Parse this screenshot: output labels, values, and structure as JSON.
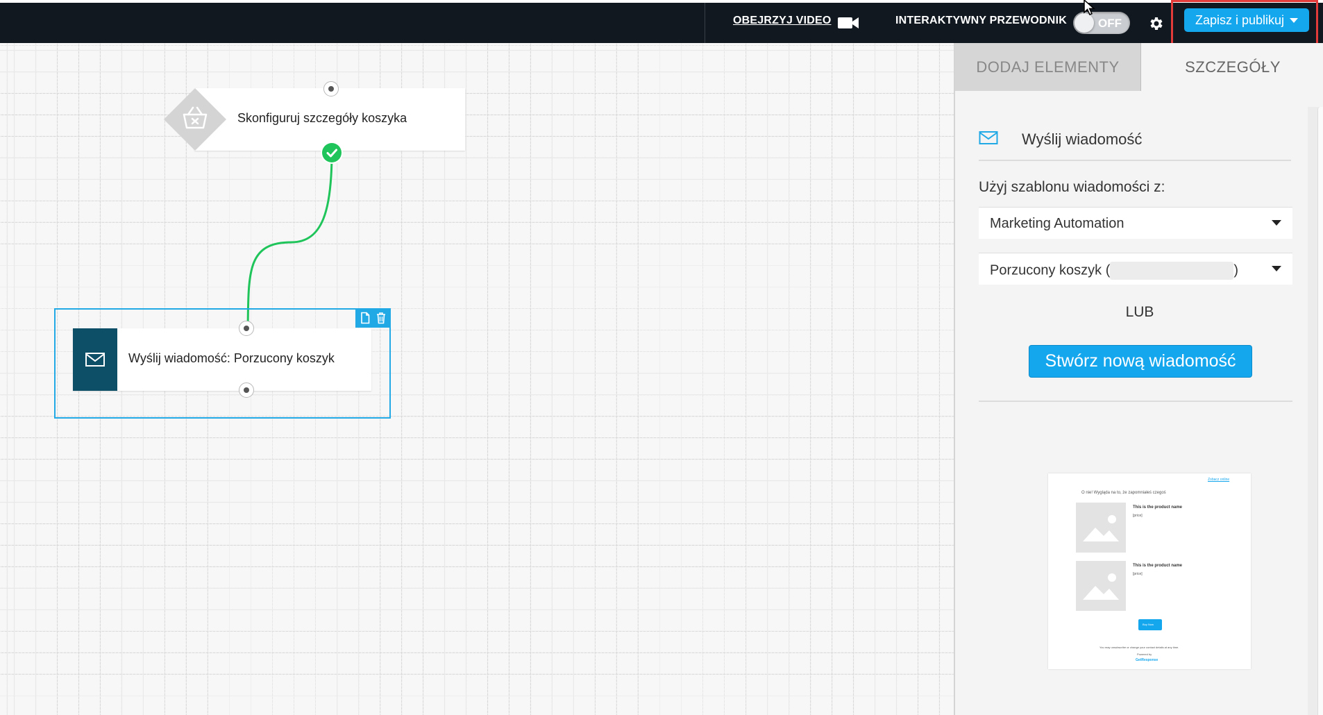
{
  "topbar": {
    "video_label": "OBEJRZYJ VIDEO",
    "video_icon": "video-camera-icon",
    "guide_label": "INTERAKTYWNY PRZEWODNIK",
    "guide_toggle_state": "OFF",
    "settings_icon": "gear-icon",
    "publish_label": "Zapisz i publikuj",
    "publish_color": "#14a7ee",
    "highlight_color": "#e33a3a"
  },
  "canvas": {
    "nodes": [
      {
        "label": "Skonfiguruj szczegóły koszyka",
        "icon": "basket-icon"
      },
      {
        "label": "Wyślij wiadomość: Porzucony koszyk",
        "icon": "envelope-icon"
      }
    ],
    "node_tools": [
      "copy-icon",
      "trash-icon"
    ],
    "connector_color": "#1fc45a",
    "selection_color": "#21a9e6"
  },
  "panel": {
    "tabs": [
      "DODAJ ELEMENTY",
      "SZCZEGÓŁY"
    ],
    "active_tab": "SZCZEGÓŁY",
    "section_title": "Wyślij wiadomość",
    "template_label": "Użyj szablonu wiadomości z:",
    "source_select": "Marketing Automation",
    "message_select_prefix": "Porzucony koszyk (",
    "message_select_suffix": ")",
    "or_label": "LUB",
    "create_button": "Stwórz nową wiadomość",
    "preview": {
      "top_link": "Zobacz online",
      "heading": "O nie! Wygląda na to, że zapomniałeś czegoś",
      "product_name_1": "This is the product name",
      "price_1": "[price]",
      "product_name_2": "This is the product name",
      "price_2": "[price]",
      "cta": "Buy Now",
      "footer": "You may unsubscribe or change your contact details at any time.",
      "powered_by": "Powered by",
      "brand": "GetResponse"
    }
  }
}
